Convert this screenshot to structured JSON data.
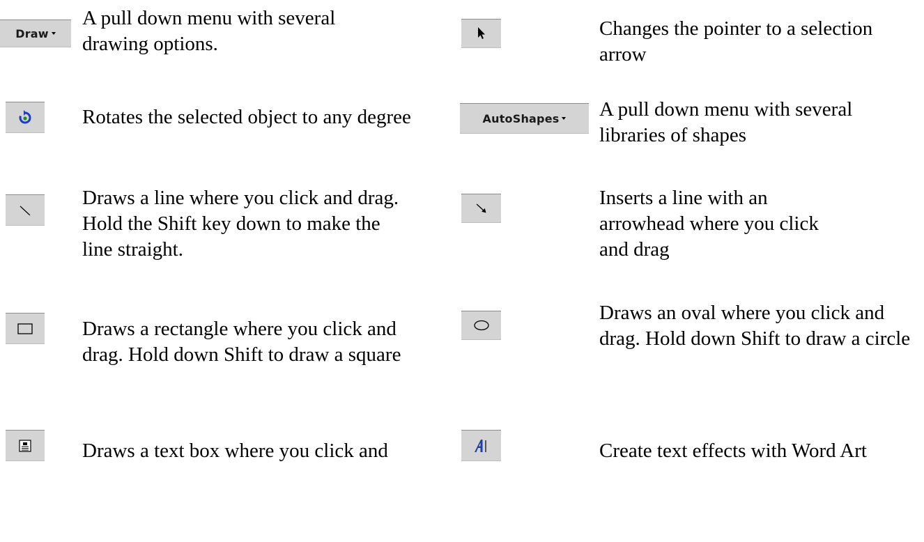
{
  "draw_menu": {
    "label": "Draw",
    "icon": "chevron-down-icon",
    "description": "A pull down menu with several drawing options."
  },
  "select_tool": {
    "icon": "pointer-arrow-icon",
    "description": "Changes the pointer to a selection arrow"
  },
  "rotate_tool": {
    "icon": "free-rotate-icon",
    "description": "Rotates the selected object to any degree"
  },
  "autoshapes_menu": {
    "label": "AutoShapes",
    "icon": "chevron-down-icon",
    "description": "A pull down menu with several libraries of shapes"
  },
  "line_tool": {
    "icon": "line-icon",
    "description": "Draws a line where you click and drag. Hold the Shift key down to make the line straight."
  },
  "arrow_tool": {
    "icon": "arrow-line-icon",
    "description": "Inserts a line with an arrowhead where you click and drag"
  },
  "rectangle_tool": {
    "icon": "rectangle-icon",
    "description": "Draws a rectangle where you click and drag. Hold down Shift to draw a square"
  },
  "oval_tool": {
    "icon": "oval-icon",
    "description": "Draws an oval where you click and drag. Hold down Shift to draw a circle"
  },
  "textbox_tool": {
    "icon": "text-box-icon",
    "description": "Draws a text box where you click and"
  },
  "wordart_tool": {
    "icon": "wordart-icon",
    "description": "Create text effects with Word Art"
  },
  "colors": {
    "button_face": "#d4d4d4",
    "rotate_blue": "#1a3cc8",
    "rotate_green": "#1e8a2a",
    "wordart_blue": "#1e3ea8"
  }
}
